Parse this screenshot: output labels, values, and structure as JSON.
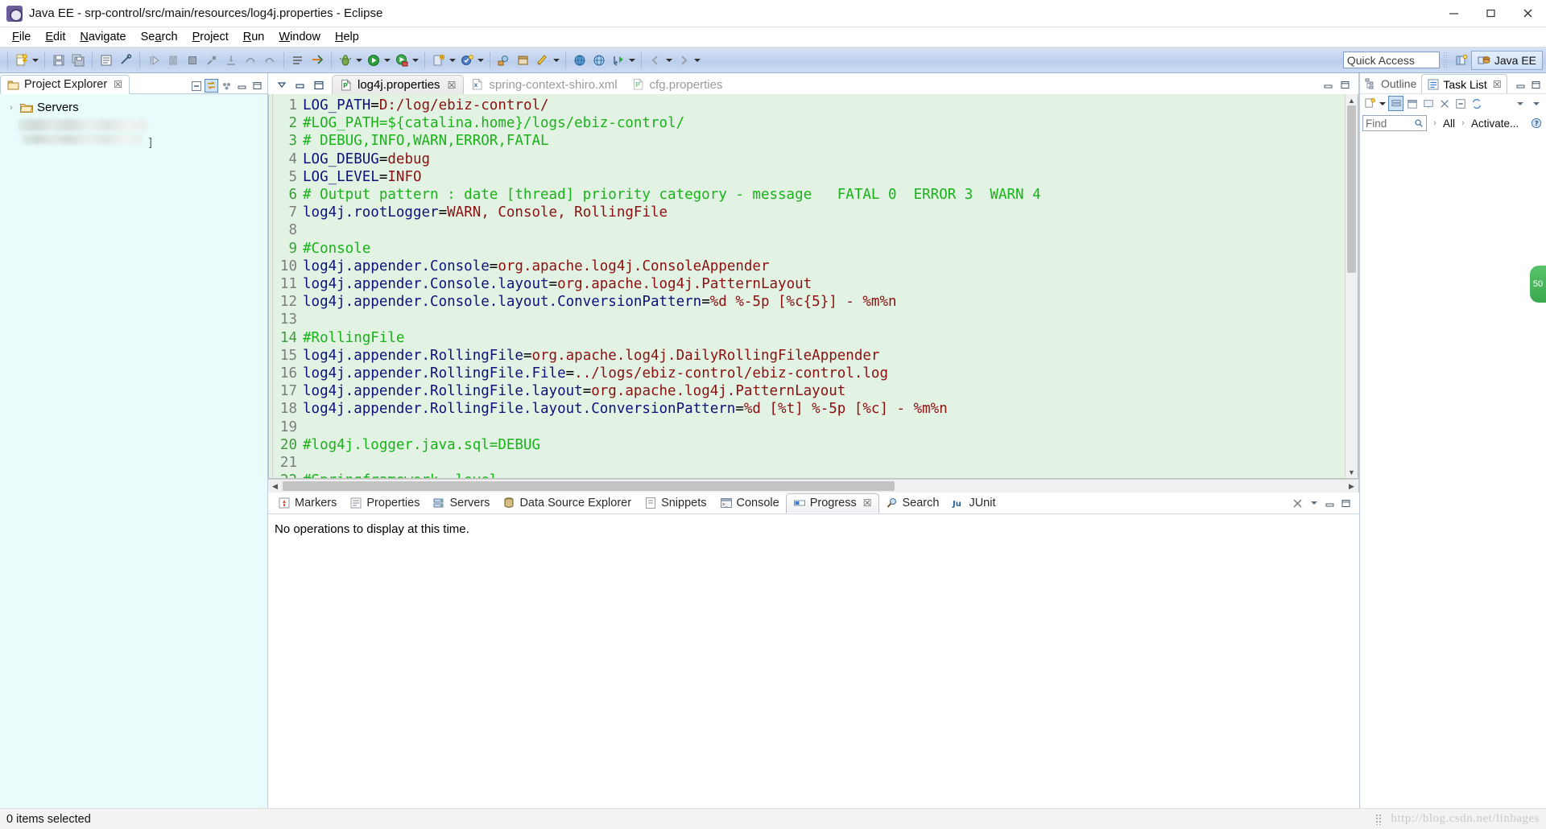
{
  "window": {
    "title": "Java EE - srp-control/src/main/resources/log4j.properties - Eclipse",
    "app_icon": "eclipse-icon",
    "minimize": "─",
    "maximize": "❐",
    "close": "✕"
  },
  "menubar": {
    "items": [
      {
        "pre": "",
        "mn": "F",
        "post": "ile"
      },
      {
        "pre": "",
        "mn": "E",
        "post": "dit"
      },
      {
        "pre": "",
        "mn": "N",
        "post": "avigate"
      },
      {
        "pre": "Se",
        "mn": "a",
        "post": "rch"
      },
      {
        "pre": "",
        "mn": "P",
        "post": "roject"
      },
      {
        "pre": "",
        "mn": "R",
        "post": "un"
      },
      {
        "pre": "",
        "mn": "W",
        "post": "indow"
      },
      {
        "pre": "",
        "mn": "H",
        "post": "elp"
      }
    ]
  },
  "toolbar": {
    "quick_access_placeholder": "Quick Access",
    "quick_access_value": "",
    "perspective_label": "Java EE",
    "open_perspective_icon": "open-perspective-icon",
    "icons": [
      "new-wizard-icon",
      "save-icon",
      "save-all-icon",
      "print-icon",
      "link-icon",
      "resume-icon",
      "suspend-icon",
      "terminate-icon",
      "disconnect-icon",
      "step-into-icon",
      "step-over-icon",
      "step-return-icon",
      "toggle-breakpoint-icon",
      "skip-breakpoints-icon",
      "debug-icon",
      "run-icon",
      "run-server-icon",
      "new-ee-artifact-icon",
      "new-annotation-icon",
      "search-icon",
      "open-type-icon",
      "open-task-icon",
      "last-edit-icon",
      "back-icon",
      "forward-icon"
    ]
  },
  "project_explorer": {
    "tab_label": "Project Explorer",
    "tab_close_icon": "close-icon",
    "tab_icon": "project-explorer-icon",
    "tools": [
      "collapse-all-icon",
      "link-with-editor-icon",
      "view-menu-icon",
      "minimize-icon",
      "maximize-icon"
    ],
    "tree": [
      {
        "label": "Servers",
        "icon": "folder-icon",
        "expander": "›",
        "redacted": false
      },
      {
        "label": "",
        "icon": "",
        "expander": "",
        "redacted": true
      },
      {
        "label": "",
        "icon": "",
        "expander": "",
        "redacted": true
      }
    ]
  },
  "editor": {
    "view_buttons": [
      "filter-icon",
      "restore-icon",
      "maximize-icon"
    ],
    "tabs": [
      {
        "label": "log4j.properties",
        "icon": "properties-file-icon",
        "active": true,
        "close_icon": "☒"
      },
      {
        "label": "spring-context-shiro.xml",
        "icon": "xml-file-icon",
        "active": false,
        "close_icon": ""
      },
      {
        "label": "cfg.properties",
        "icon": "properties-file-icon",
        "active": false,
        "close_icon": ""
      }
    ],
    "right_buttons": [
      "minimize-icon",
      "maximize-icon"
    ],
    "scroll_up_arrow": "▲",
    "scroll_down_arrow": "▼",
    "scroll_left_arrow": "◀",
    "scroll_right_arrow": "▶",
    "lines": [
      {
        "n": 1,
        "gnum": false,
        "parts": [
          {
            "t": "LOG_PATH",
            "c": "k"
          },
          {
            "t": "=",
            "c": "eq"
          },
          {
            "t": "D:/log/ebiz-control/",
            "c": "v"
          }
        ]
      },
      {
        "n": 2,
        "gnum": true,
        "parts": [
          {
            "t": "#LOG_PATH=${catalina.home}/logs/ebiz-control/",
            "c": "cm"
          }
        ]
      },
      {
        "n": 3,
        "gnum": true,
        "parts": [
          {
            "t": "# DEBUG,INFO,WARN,ERROR,FATAL",
            "c": "cm"
          }
        ]
      },
      {
        "n": 4,
        "gnum": false,
        "parts": [
          {
            "t": "LOG_DEBUG",
            "c": "k"
          },
          {
            "t": "=",
            "c": "eq"
          },
          {
            "t": "debug",
            "c": "v"
          }
        ]
      },
      {
        "n": 5,
        "gnum": false,
        "parts": [
          {
            "t": "LOG_LEVEL",
            "c": "k"
          },
          {
            "t": "=",
            "c": "eq"
          },
          {
            "t": "INFO",
            "c": "v"
          }
        ]
      },
      {
        "n": 6,
        "gnum": true,
        "parts": [
          {
            "t": "# Output pattern : date [thread] priority category - message   FATAL 0  ERROR 3  WARN 4",
            "c": "cm"
          }
        ]
      },
      {
        "n": 7,
        "gnum": false,
        "parts": [
          {
            "t": "log4j.rootLogger",
            "c": "k"
          },
          {
            "t": "=",
            "c": "eq"
          },
          {
            "t": "WARN, Console, RollingFile",
            "c": "v"
          }
        ]
      },
      {
        "n": 8,
        "gnum": false,
        "parts": []
      },
      {
        "n": 9,
        "gnum": true,
        "parts": [
          {
            "t": "#Console",
            "c": "cm"
          }
        ]
      },
      {
        "n": 10,
        "gnum": false,
        "parts": [
          {
            "t": "log4j.appender.Console",
            "c": "k"
          },
          {
            "t": "=",
            "c": "eq"
          },
          {
            "t": "org.apache.log4j.ConsoleAppender",
            "c": "v"
          }
        ]
      },
      {
        "n": 11,
        "gnum": false,
        "parts": [
          {
            "t": "log4j.appender.Console.layout",
            "c": "k"
          },
          {
            "t": "=",
            "c": "eq"
          },
          {
            "t": "org.apache.log4j.PatternLayout",
            "c": "v"
          }
        ]
      },
      {
        "n": 12,
        "gnum": false,
        "parts": [
          {
            "t": "log4j.appender.Console.layout.ConversionPattern",
            "c": "k"
          },
          {
            "t": "=",
            "c": "eq"
          },
          {
            "t": "%d %-5p [%c{5}] - %m%n",
            "c": "v"
          }
        ]
      },
      {
        "n": 13,
        "gnum": false,
        "parts": []
      },
      {
        "n": 14,
        "gnum": true,
        "parts": [
          {
            "t": "#RollingFile",
            "c": "cm"
          }
        ]
      },
      {
        "n": 15,
        "gnum": false,
        "parts": [
          {
            "t": "log4j.appender.RollingFile",
            "c": "k"
          },
          {
            "t": "=",
            "c": "eq"
          },
          {
            "t": "org.apache.log4j.DailyRollingFileAppender",
            "c": "v"
          }
        ]
      },
      {
        "n": 16,
        "gnum": false,
        "parts": [
          {
            "t": "log4j.appender.RollingFile.File",
            "c": "k"
          },
          {
            "t": "=",
            "c": "eq"
          },
          {
            "t": "../logs/ebiz-control/ebiz-control.log",
            "c": "v"
          }
        ]
      },
      {
        "n": 17,
        "gnum": false,
        "parts": [
          {
            "t": "log4j.appender.RollingFile.layout",
            "c": "k"
          },
          {
            "t": "=",
            "c": "eq"
          },
          {
            "t": "org.apache.log4j.PatternLayout",
            "c": "v"
          }
        ]
      },
      {
        "n": 18,
        "gnum": false,
        "parts": [
          {
            "t": "log4j.appender.RollingFile.layout.ConversionPattern",
            "c": "k"
          },
          {
            "t": "=",
            "c": "eq"
          },
          {
            "t": "%d [%t] %-5p [%c] - %m%n",
            "c": "v"
          }
        ]
      },
      {
        "n": 19,
        "gnum": false,
        "parts": []
      },
      {
        "n": 20,
        "gnum": true,
        "parts": [
          {
            "t": "#log4j.logger.java.sql=DEBUG",
            "c": "cm"
          }
        ]
      },
      {
        "n": 21,
        "gnum": false,
        "parts": []
      },
      {
        "n": 22,
        "gnum": true,
        "parts": [
          {
            "t": "#Springframework  level",
            "c": "cm"
          }
        ]
      }
    ]
  },
  "bottom_panel": {
    "tabs": [
      {
        "label": "Markers",
        "icon": "markers-icon",
        "active": false
      },
      {
        "label": "Properties",
        "icon": "properties-icon",
        "active": false
      },
      {
        "label": "Servers",
        "icon": "servers-icon",
        "active": false
      },
      {
        "label": "Data Source Explorer",
        "icon": "data-source-icon",
        "active": false
      },
      {
        "label": "Snippets",
        "icon": "snippets-icon",
        "active": false
      },
      {
        "label": "Console",
        "icon": "console-icon",
        "active": false
      },
      {
        "label": "Progress",
        "icon": "progress-icon",
        "active": true,
        "close_icon": "☒"
      },
      {
        "label": "Search",
        "icon": "search-view-icon",
        "active": false
      },
      {
        "label": "JUnit",
        "icon": "junit-icon",
        "active": false
      }
    ],
    "tools": [
      "cancel-all-icon",
      "view-menu-icon",
      "minimize-icon",
      "maximize-icon"
    ],
    "message": "No operations to display at this time."
  },
  "right_panel": {
    "tabs": [
      {
        "label": "Outline",
        "icon": "outline-icon",
        "active": false
      },
      {
        "label": "Task List",
        "icon": "task-list-icon",
        "active": true,
        "close_icon": "☒"
      }
    ],
    "window_buttons": [
      "minimize-icon",
      "maximize-icon"
    ],
    "toolbar_icons": [
      "new-task-icon",
      "dropdown-icon",
      "categorize-icon",
      "schedule-icon",
      "presentation-icon",
      "focus-icon",
      "collapse-all-icon",
      "synchronize-icon",
      "view-menu-icon",
      "more-icon"
    ],
    "find": {
      "placeholder": "Find",
      "value": "",
      "clear_icon": "search-clear-icon"
    },
    "filter_all_label": "All",
    "activate_label": "Activate...",
    "help_icon": "help-icon"
  },
  "statusbar": {
    "selection_text": "0 items selected",
    "watermark": "http://blog.csdn.net/linbages"
  },
  "side_badge": {
    "label": "50"
  },
  "colors": {
    "editor_background": "#e2f3e4",
    "explorer_background": "#e9fbfb",
    "comment": "#19b219",
    "key": "#10107a",
    "value": "#8b1010",
    "toolbar_gradient_top": "#d6e2f5",
    "toolbar_gradient_bottom": "#cfdcf3",
    "accent_tab_border": "#b8cbe0"
  }
}
